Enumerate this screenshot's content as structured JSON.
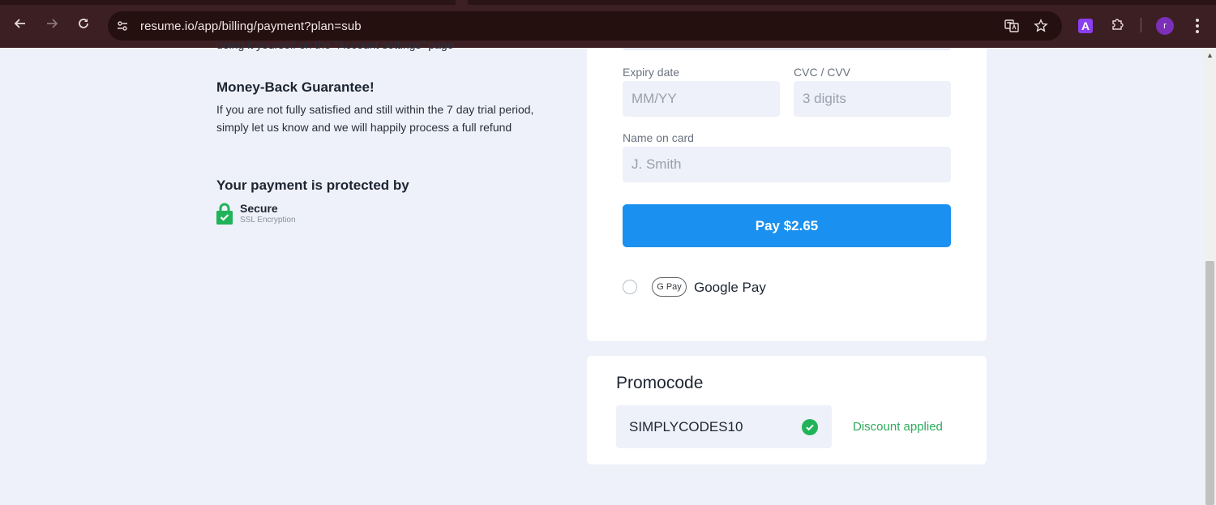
{
  "browser": {
    "url": "resume.io/app/billing/payment?plan=sub",
    "extension_label": "A",
    "profile_initial": "r"
  },
  "left": {
    "cut_text": "doing it yourself on the \"Account settings\" page",
    "money_back": {
      "title": "Money-Back Guarantee!",
      "body": "If you are not fully satisfied and still within the 7 day trial period, simply let us know and we will happily process a full refund"
    },
    "protection": {
      "title": "Your payment is protected by",
      "badge_title": "Secure",
      "badge_subtitle": "SSL Encryption"
    }
  },
  "payment": {
    "expiry": {
      "label": "Expiry date",
      "placeholder": "MM/YY"
    },
    "cvc": {
      "label": "CVC / CVV",
      "placeholder": "3 digits"
    },
    "name": {
      "label": "Name on card",
      "placeholder": "J. Smith"
    },
    "pay_button": "Pay $2.65",
    "gpay": {
      "badge": "G Pay",
      "label": "Google Pay"
    }
  },
  "promo": {
    "title": "Promocode",
    "value": "SIMPLYCODES10",
    "status": "Discount applied"
  },
  "colors": {
    "primary": "#1a91f0",
    "success": "#2eaa5c",
    "browser_chrome": "#3c1f23"
  }
}
